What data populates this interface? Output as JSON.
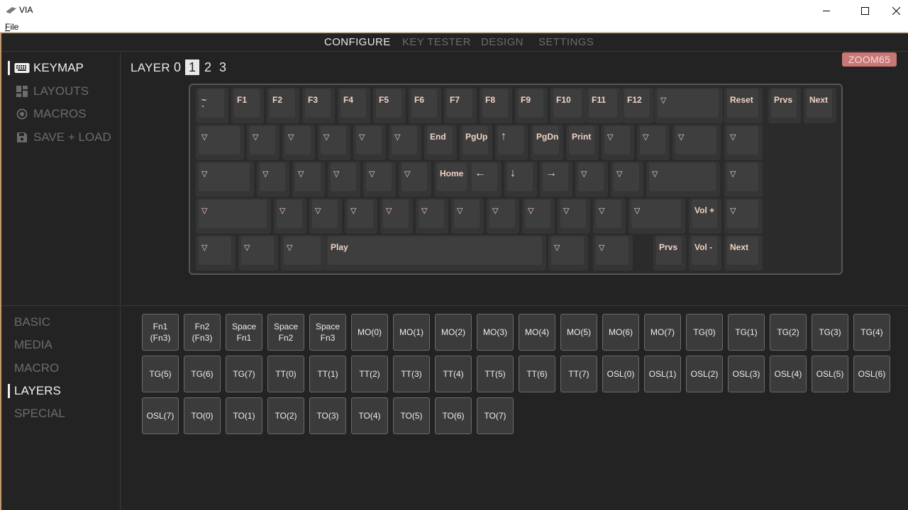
{
  "window": {
    "title": "VIA",
    "menu": {
      "file": "File"
    },
    "controls": {
      "minimize": "—",
      "maximize": "☐",
      "close": "✕"
    }
  },
  "topnav": {
    "tabs": [
      {
        "label": "CONFIGURE",
        "active": true
      },
      {
        "label": "KEY TESTER",
        "active": false
      },
      {
        "label": "DESIGN",
        "active": false
      },
      {
        "label": "SETTINGS",
        "active": false
      }
    ]
  },
  "sidebar": {
    "items": [
      {
        "label": "KEYMAP",
        "icon": "keyboard-icon",
        "active": true
      },
      {
        "label": "LAYOUTS",
        "icon": "layouts-icon",
        "active": false
      },
      {
        "label": "MACROS",
        "icon": "macros-icon",
        "active": false
      },
      {
        "label": "SAVE + LOAD",
        "icon": "save-icon",
        "active": false
      }
    ],
    "categories": [
      {
        "label": "BASIC",
        "active": false
      },
      {
        "label": "MEDIA",
        "active": false
      },
      {
        "label": "MACRO",
        "active": false
      },
      {
        "label": "LAYERS",
        "active": true
      },
      {
        "label": "SPECIAL",
        "active": false
      }
    ]
  },
  "layers": {
    "label": "LAYER",
    "options": [
      "0",
      "1",
      "2",
      "3"
    ],
    "selected": "1"
  },
  "device": {
    "name": "ZOOM65"
  },
  "keyboard": {
    "rows": [
      [
        "~\n`",
        "F1",
        "F2",
        "F3",
        "F4",
        "F5",
        "F6",
        "F7",
        "F8",
        "F9",
        "F10",
        "F11",
        "F12",
        "▽",
        "Reset",
        "Prvs",
        "Next"
      ],
      [
        "▽",
        "▽",
        "▽",
        "▽",
        "▽",
        "▽",
        "End",
        "PgUp",
        "↑",
        "PgDn",
        "Print",
        "▽",
        "▽",
        "▽",
        "▽"
      ],
      [
        "▽",
        "▽",
        "▽",
        "▽",
        "▽",
        "▽",
        "Home",
        "←",
        "↓",
        "→",
        "▽",
        "▽",
        "▽",
        "▽"
      ],
      [
        "▽",
        "▽",
        "▽",
        "▽",
        "▽",
        "▽",
        "▽",
        "▽",
        "▽",
        "▽",
        "▽",
        "▽",
        "Vol +",
        "▽"
      ],
      [
        "▽",
        "▽",
        "▽",
        "Play",
        "▽",
        "▽",
        "Prvs",
        "Vol -",
        "Next"
      ]
    ]
  },
  "keycodes": [
    "Fn1\n(Fn3)",
    "Fn2\n(Fn3)",
    "Space\nFn1",
    "Space\nFn2",
    "Space\nFn3",
    "MO(0)",
    "MO(1)",
    "MO(2)",
    "MO(3)",
    "MO(4)",
    "MO(5)",
    "MO(6)",
    "MO(7)",
    "TG(0)",
    "TG(1)",
    "TG(2)",
    "TG(3)",
    "TG(4)",
    "TG(5)",
    "TG(6)",
    "TG(7)",
    "TT(0)",
    "TT(1)",
    "TT(2)",
    "TT(3)",
    "TT(4)",
    "TT(5)",
    "TT(6)",
    "TT(7)",
    "OSL(0)",
    "OSL(1)",
    "OSL(2)",
    "OSL(3)",
    "OSL(4)",
    "OSL(5)",
    "OSL(6)",
    "OSL(7)",
    "TO(0)",
    "TO(1)",
    "TO(2)",
    "TO(3)",
    "TO(4)",
    "TO(5)",
    "TO(6)",
    "TO(7)"
  ],
  "colors": {
    "background": "#232323",
    "accent_border": "#c49a6c",
    "key_legend": "#f2d3c5",
    "badge": "#c97676"
  }
}
